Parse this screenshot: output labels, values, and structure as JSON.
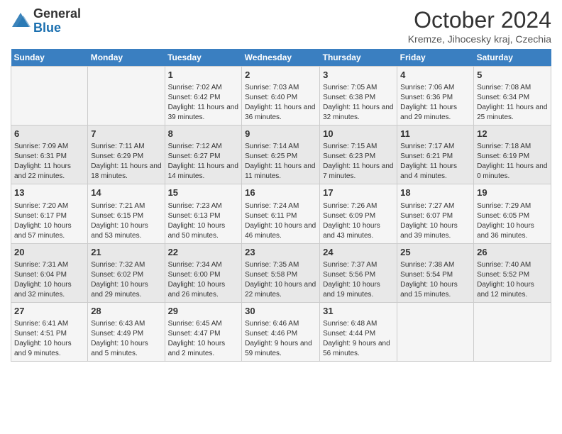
{
  "header": {
    "logo_general": "General",
    "logo_blue": "Blue",
    "month": "October 2024",
    "location": "Kremze, Jihocesky kraj, Czechia"
  },
  "days_of_week": [
    "Sunday",
    "Monday",
    "Tuesday",
    "Wednesday",
    "Thursday",
    "Friday",
    "Saturday"
  ],
  "weeks": [
    [
      {
        "day": "",
        "content": ""
      },
      {
        "day": "",
        "content": ""
      },
      {
        "day": "1",
        "content": "Sunrise: 7:02 AM\nSunset: 6:42 PM\nDaylight: 11 hours and 39 minutes."
      },
      {
        "day": "2",
        "content": "Sunrise: 7:03 AM\nSunset: 6:40 PM\nDaylight: 11 hours and 36 minutes."
      },
      {
        "day": "3",
        "content": "Sunrise: 7:05 AM\nSunset: 6:38 PM\nDaylight: 11 hours and 32 minutes."
      },
      {
        "day": "4",
        "content": "Sunrise: 7:06 AM\nSunset: 6:36 PM\nDaylight: 11 hours and 29 minutes."
      },
      {
        "day": "5",
        "content": "Sunrise: 7:08 AM\nSunset: 6:34 PM\nDaylight: 11 hours and 25 minutes."
      }
    ],
    [
      {
        "day": "6",
        "content": "Sunrise: 7:09 AM\nSunset: 6:31 PM\nDaylight: 11 hours and 22 minutes."
      },
      {
        "day": "7",
        "content": "Sunrise: 7:11 AM\nSunset: 6:29 PM\nDaylight: 11 hours and 18 minutes."
      },
      {
        "day": "8",
        "content": "Sunrise: 7:12 AM\nSunset: 6:27 PM\nDaylight: 11 hours and 14 minutes."
      },
      {
        "day": "9",
        "content": "Sunrise: 7:14 AM\nSunset: 6:25 PM\nDaylight: 11 hours and 11 minutes."
      },
      {
        "day": "10",
        "content": "Sunrise: 7:15 AM\nSunset: 6:23 PM\nDaylight: 11 hours and 7 minutes."
      },
      {
        "day": "11",
        "content": "Sunrise: 7:17 AM\nSunset: 6:21 PM\nDaylight: 11 hours and 4 minutes."
      },
      {
        "day": "12",
        "content": "Sunrise: 7:18 AM\nSunset: 6:19 PM\nDaylight: 11 hours and 0 minutes."
      }
    ],
    [
      {
        "day": "13",
        "content": "Sunrise: 7:20 AM\nSunset: 6:17 PM\nDaylight: 10 hours and 57 minutes."
      },
      {
        "day": "14",
        "content": "Sunrise: 7:21 AM\nSunset: 6:15 PM\nDaylight: 10 hours and 53 minutes."
      },
      {
        "day": "15",
        "content": "Sunrise: 7:23 AM\nSunset: 6:13 PM\nDaylight: 10 hours and 50 minutes."
      },
      {
        "day": "16",
        "content": "Sunrise: 7:24 AM\nSunset: 6:11 PM\nDaylight: 10 hours and 46 minutes."
      },
      {
        "day": "17",
        "content": "Sunrise: 7:26 AM\nSunset: 6:09 PM\nDaylight: 10 hours and 43 minutes."
      },
      {
        "day": "18",
        "content": "Sunrise: 7:27 AM\nSunset: 6:07 PM\nDaylight: 10 hours and 39 minutes."
      },
      {
        "day": "19",
        "content": "Sunrise: 7:29 AM\nSunset: 6:05 PM\nDaylight: 10 hours and 36 minutes."
      }
    ],
    [
      {
        "day": "20",
        "content": "Sunrise: 7:31 AM\nSunset: 6:04 PM\nDaylight: 10 hours and 32 minutes."
      },
      {
        "day": "21",
        "content": "Sunrise: 7:32 AM\nSunset: 6:02 PM\nDaylight: 10 hours and 29 minutes."
      },
      {
        "day": "22",
        "content": "Sunrise: 7:34 AM\nSunset: 6:00 PM\nDaylight: 10 hours and 26 minutes."
      },
      {
        "day": "23",
        "content": "Sunrise: 7:35 AM\nSunset: 5:58 PM\nDaylight: 10 hours and 22 minutes."
      },
      {
        "day": "24",
        "content": "Sunrise: 7:37 AM\nSunset: 5:56 PM\nDaylight: 10 hours and 19 minutes."
      },
      {
        "day": "25",
        "content": "Sunrise: 7:38 AM\nSunset: 5:54 PM\nDaylight: 10 hours and 15 minutes."
      },
      {
        "day": "26",
        "content": "Sunrise: 7:40 AM\nSunset: 5:52 PM\nDaylight: 10 hours and 12 minutes."
      }
    ],
    [
      {
        "day": "27",
        "content": "Sunrise: 6:41 AM\nSunset: 4:51 PM\nDaylight: 10 hours and 9 minutes."
      },
      {
        "day": "28",
        "content": "Sunrise: 6:43 AM\nSunset: 4:49 PM\nDaylight: 10 hours and 5 minutes."
      },
      {
        "day": "29",
        "content": "Sunrise: 6:45 AM\nSunset: 4:47 PM\nDaylight: 10 hours and 2 minutes."
      },
      {
        "day": "30",
        "content": "Sunrise: 6:46 AM\nSunset: 4:46 PM\nDaylight: 9 hours and 59 minutes."
      },
      {
        "day": "31",
        "content": "Sunrise: 6:48 AM\nSunset: 4:44 PM\nDaylight: 9 hours and 56 minutes."
      },
      {
        "day": "",
        "content": ""
      },
      {
        "day": "",
        "content": ""
      }
    ]
  ]
}
